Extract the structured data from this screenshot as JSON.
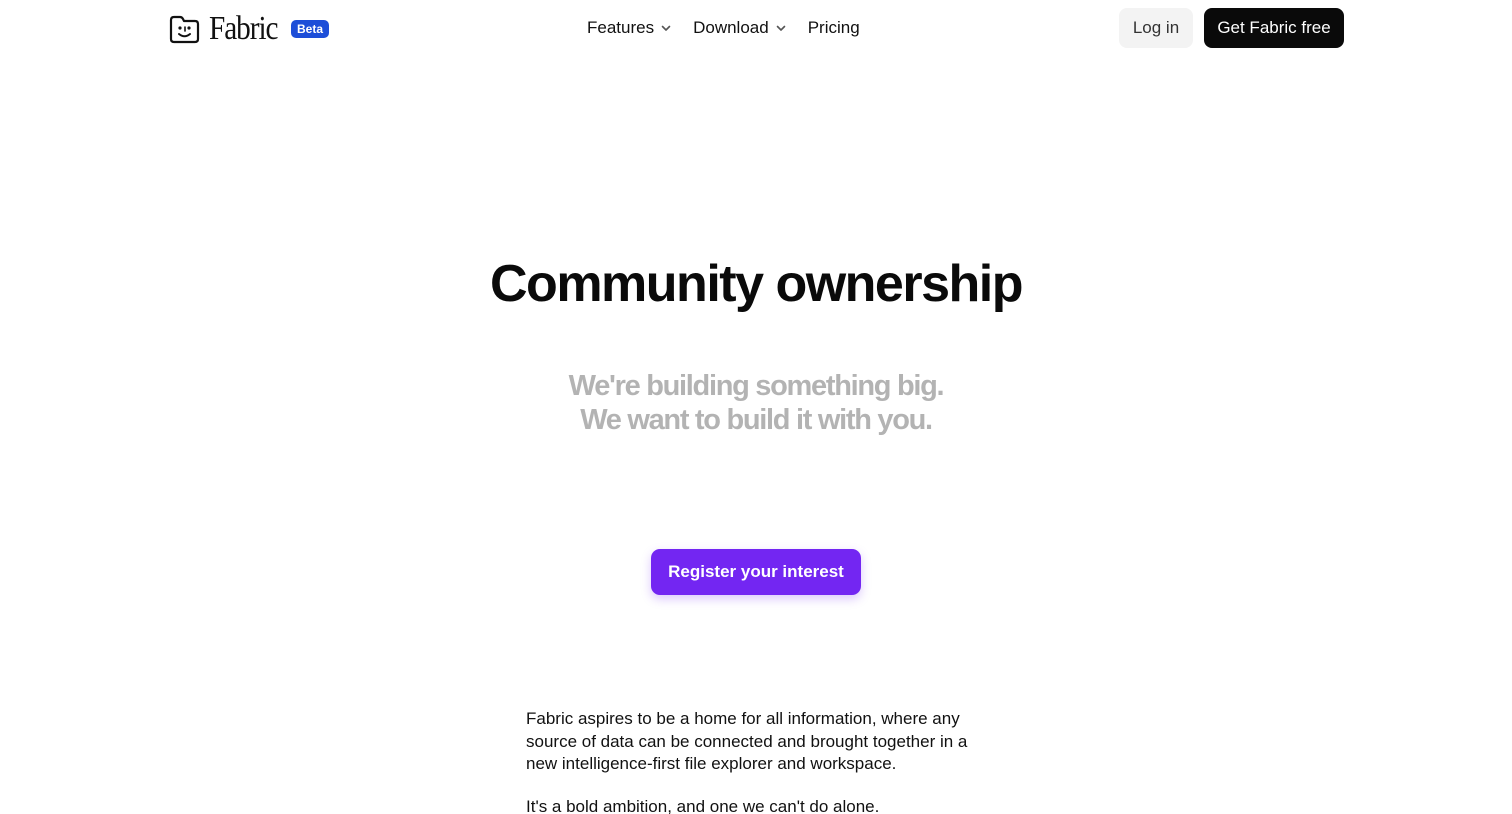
{
  "header": {
    "logo": {
      "icon": "smiling-folder-icon",
      "text": "Fabric",
      "badge": "Beta",
      "badge_color": "#1d4ed8"
    },
    "nav": [
      {
        "label": "Features",
        "has_dropdown": true
      },
      {
        "label": "Download",
        "has_dropdown": true
      },
      {
        "label": "Pricing",
        "has_dropdown": false
      }
    ],
    "login_label": "Log in",
    "cta_label": "Get Fabric free"
  },
  "hero": {
    "title": "Community ownership",
    "subtitle_line1": "We're building something big.",
    "subtitle_line2": "We want to build it with you.",
    "button_label": "Register your interest",
    "button_color": "#7326f2"
  },
  "body": {
    "paragraph1": "Fabric aspires to be a home for all information, where any source of data can be connected and brought together in a new intelligence-first file explorer and workspace.",
    "paragraph2": "It's a bold ambition, and one we can't do alone."
  }
}
